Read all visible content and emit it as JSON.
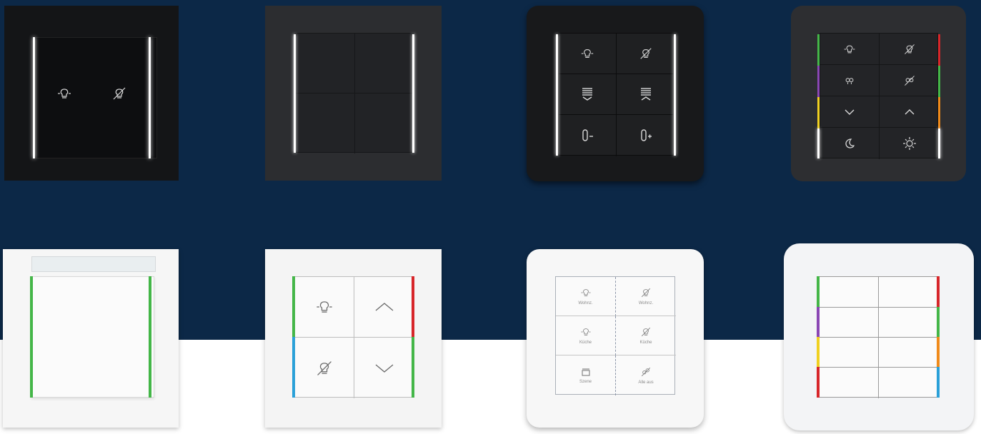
{
  "colors": {
    "background_top": "#0c2847",
    "background_bottom": "#ffffff",
    "frame_dark": "#2b2c2e",
    "frame_black": "#111214",
    "frame_white": "#f3f3f3",
    "led_white": "#ffffff",
    "led_green": "#44b648",
    "led_red": "#d7262a",
    "led_purple": "#8a46b4",
    "led_yellow": "#f0d020",
    "led_orange": "#f08a1a",
    "led_blue": "#2aa0d8"
  },
  "switches": {
    "s3": {
      "labels": [
        "Wohnz.",
        "Wohnz.",
        "Küche",
        "Küche",
        "Szene",
        "Alle aus"
      ]
    }
  }
}
